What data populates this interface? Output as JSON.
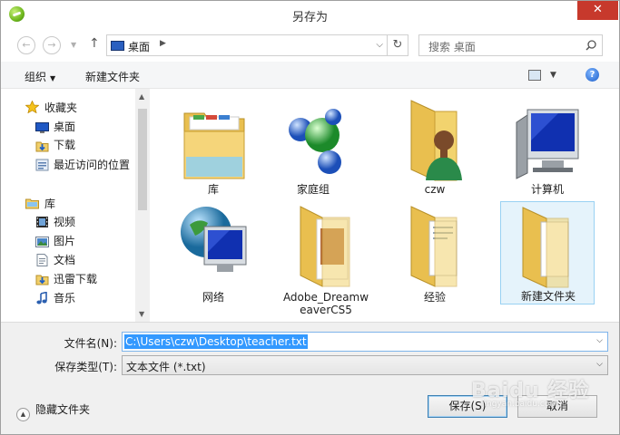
{
  "window": {
    "title": "另存为",
    "close_glyph": "✕"
  },
  "nav": {
    "back_glyph": "←",
    "forward_glyph": "→",
    "up_glyph": "↑",
    "address": {
      "location": "桌面"
    },
    "search": {
      "placeholder": "搜索 桌面"
    }
  },
  "toolbar": {
    "organize_label": "组织",
    "new_folder_label": "新建文件夹"
  },
  "sidebar": {
    "items": [
      {
        "label": "收藏夹",
        "icon": "star-icon"
      },
      {
        "label": "桌面",
        "icon": "desktop-icon"
      },
      {
        "label": "下载",
        "icon": "download-icon"
      },
      {
        "label": "最近访问的位置",
        "icon": "recent-places-icon"
      },
      {
        "label": "库",
        "icon": "library-icon"
      },
      {
        "label": "视频",
        "icon": "video-icon"
      },
      {
        "label": "图片",
        "icon": "picture-icon"
      },
      {
        "label": "文档",
        "icon": "document-icon"
      },
      {
        "label": "迅雷下载",
        "icon": "thunder-download-icon"
      },
      {
        "label": "音乐",
        "icon": "music-icon"
      }
    ]
  },
  "files": [
    {
      "label": "库",
      "icon": "library-folder-icon"
    },
    {
      "label": "家庭组",
      "icon": "homegroup-icon"
    },
    {
      "label": "czw",
      "icon": "user-folder-icon"
    },
    {
      "label": "计算机",
      "icon": "computer-icon"
    },
    {
      "label": "网络",
      "icon": "network-icon"
    },
    {
      "label": "Adobe_Dreamw",
      "label2": "eaverCS5",
      "icon": "folder-icon"
    },
    {
      "label": "经验",
      "icon": "folder-icon"
    },
    {
      "label": "新建文件夹",
      "icon": "folder-icon",
      "selected": true
    }
  ],
  "form": {
    "filename_label": "文件名(N):",
    "filename_value": "C:\\Users\\czw\\Desktop\\teacher.txt",
    "filetype_label": "保存类型(T):",
    "filetype_value": "文本文件 (*.txt)",
    "hide_folders_label": "隐藏文件夹",
    "save_label": "保存(S)",
    "cancel_label": "取消"
  },
  "watermark": {
    "text": "Baidu 经验",
    "sub": "jingyan.baidu.com"
  }
}
